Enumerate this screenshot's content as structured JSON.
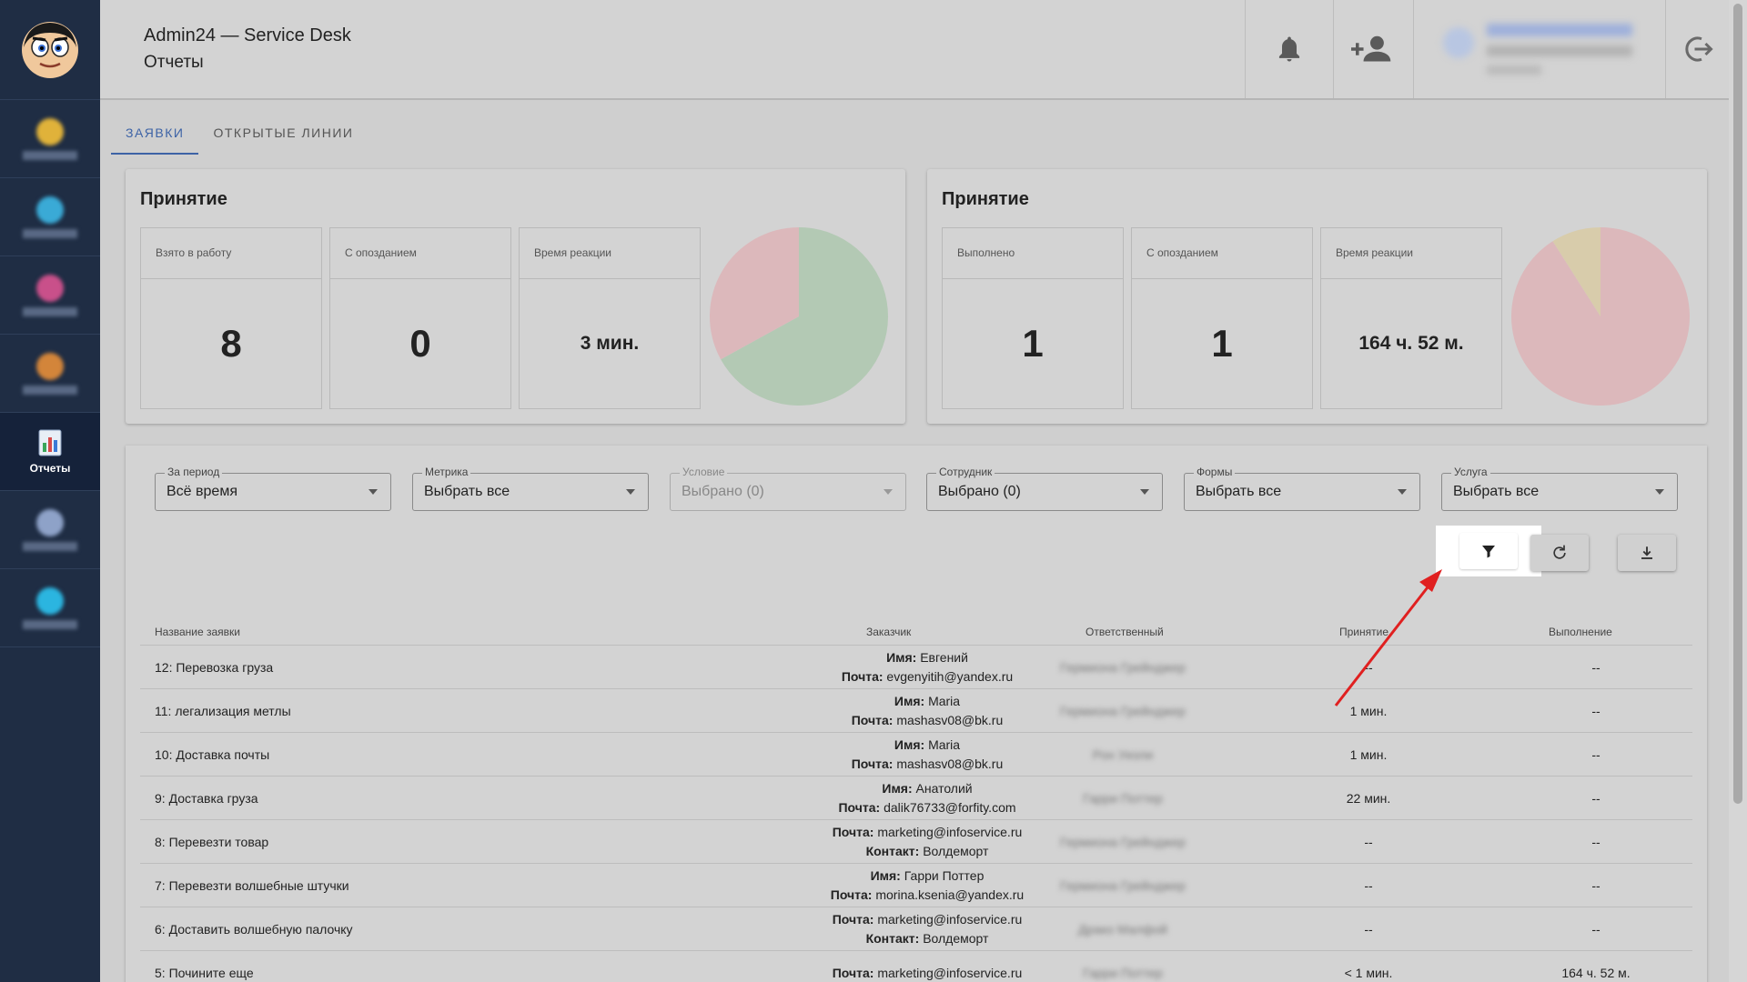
{
  "header": {
    "app_title": "Admin24 — Service Desk",
    "page_title": "Отчеты"
  },
  "sidebar": {
    "items": [
      {
        "label": "Отчеты",
        "icon": "reports-icon",
        "active": true
      }
    ]
  },
  "tabs": [
    {
      "label": "Заявки",
      "active": true
    },
    {
      "label": "Открытые линии",
      "active": false
    }
  ],
  "cards": [
    {
      "title": "Принятие",
      "stats": [
        {
          "label": "Взято в работу",
          "value": "8"
        },
        {
          "label": "С опозданием",
          "value": "0"
        },
        {
          "label": "Время реакции",
          "value": "3 мин."
        }
      ],
      "pie": {
        "slices": [
          {
            "value": 0.67,
            "color": "#b3c9b4"
          },
          {
            "value": 0.33,
            "color": "#dcb8bb"
          }
        ]
      }
    },
    {
      "title": "Принятие",
      "stats": [
        {
          "label": "Выполнено",
          "value": "1"
        },
        {
          "label": "С опозданием",
          "value": "1"
        },
        {
          "label": "Время реакции",
          "value": "164 ч. 52 м."
        }
      ],
      "pie": {
        "slices": [
          {
            "value": 0.91,
            "color": "#dcb8bb"
          },
          {
            "value": 0.09,
            "color": "#d8ccab"
          }
        ]
      }
    }
  ],
  "filters": [
    {
      "label": "За период",
      "value": "Всё время",
      "disabled": false
    },
    {
      "label": "Метрика",
      "value": "Выбрать все",
      "disabled": false
    },
    {
      "label": "Условие",
      "value": "Выбрано (0)",
      "disabled": true
    },
    {
      "label": "Сотрудник",
      "value": "Выбрано (0)",
      "disabled": false
    },
    {
      "label": "Формы",
      "value": "Выбрать все",
      "disabled": false
    },
    {
      "label": "Услуга",
      "value": "Выбрать все",
      "disabled": false
    }
  ],
  "table": {
    "headers": {
      "name": "Название заявки",
      "customer": "Заказчик",
      "responsible": "Ответственный",
      "accept": "Принятие",
      "done": "Выполнение"
    },
    "rows": [
      {
        "name": "12: Перевозка груза",
        "c1k": "Имя:",
        "c1v": "Евгений",
        "c2k": "Почта:",
        "c2v": "evgenyitih@yandex.ru",
        "resp": "Гермиона Грейнджер",
        "accept": "--",
        "done": "--"
      },
      {
        "name": "11: легализация метлы",
        "c1k": "Имя:",
        "c1v": "Maria",
        "c2k": "Почта:",
        "c2v": "mashasv08@bk.ru",
        "resp": "Гермиона Грейнджер",
        "accept": "1 мин.",
        "done": "--"
      },
      {
        "name": "10: Доставка почты",
        "c1k": "Имя:",
        "c1v": "Maria",
        "c2k": "Почта:",
        "c2v": "mashasv08@bk.ru",
        "resp": "Рон Уизли",
        "accept": "1 мин.",
        "done": "--"
      },
      {
        "name": "9: Доставка груза",
        "c1k": "Имя:",
        "c1v": "Анатолий",
        "c2k": "Почта:",
        "c2v": "dalik76733@forfity.com",
        "resp": "Гарри Поттер",
        "accept": "22 мин.",
        "done": "--"
      },
      {
        "name": "8: Перевезти товар",
        "c1k": "Почта:",
        "c1v": "marketing@infoservice.ru",
        "c2k": "Контакт:",
        "c2v": "Волдеморт",
        "resp": "Гермиона Грейнджер",
        "accept": "--",
        "done": "--"
      },
      {
        "name": "7: Перевезти волшебные штучки",
        "c1k": "Имя:",
        "c1v": "Гарри Поттер",
        "c2k": "Почта:",
        "c2v": "morina.ksenia@yandex.ru",
        "resp": "Гермиона Грейнджер",
        "accept": "--",
        "done": "--"
      },
      {
        "name": "6: Доставить волшебную палочку",
        "c1k": "Почта:",
        "c1v": "marketing@infoservice.ru",
        "c2k": "Контакт:",
        "c2v": "Волдеморт",
        "resp": "Драко Малфой",
        "accept": "--",
        "done": "--"
      },
      {
        "name": "5: Почините еще",
        "c1k": "Почта:",
        "c1v": "marketing@infoservice.ru",
        "c2k": "",
        "c2v": "",
        "resp": "Гарри Поттер",
        "accept": "< 1 мин.",
        "done": "164 ч. 52 м."
      }
    ]
  },
  "icons": {
    "bell": "bell-icon",
    "add_user": "add-user-icon",
    "logout": "logout-icon",
    "filter": "filter-icon",
    "refresh": "refresh-icon",
    "download": "download-icon"
  },
  "colors": {
    "accent": "#3d63a6",
    "sidebar": "#1f2d44",
    "annotation_arrow": "#e02020"
  }
}
